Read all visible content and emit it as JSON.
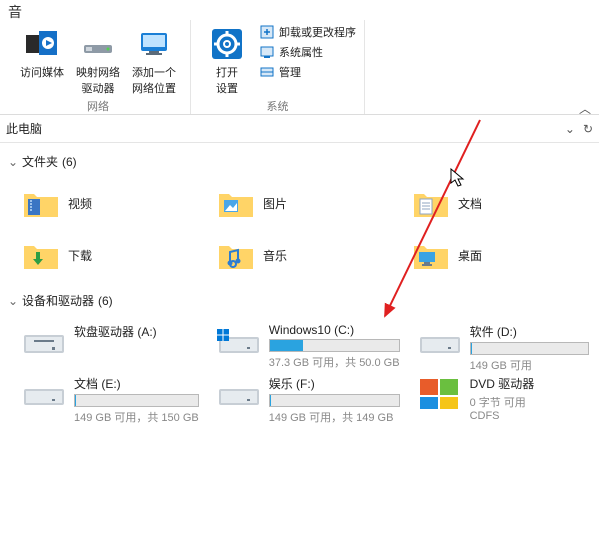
{
  "ribbon": {
    "topchar": "音",
    "btn_media": "访问媒体",
    "btn_mapnet": "映射网络\n驱动器",
    "btn_addloc": "添加一个\n网络位置",
    "group_network": "网络",
    "btn_opensettings": "打开\n设置",
    "item_uninstall": "卸载或更改程序",
    "item_sysprop": "系统属性",
    "item_manage": "管理",
    "group_system": "系统"
  },
  "pathbar": {
    "title": "此电脑"
  },
  "sections": {
    "folders_label": "文件夹",
    "folders_count": "(6)",
    "drives_label": "设备和驱动器",
    "drives_count": "(6)"
  },
  "folders": [
    {
      "label": "视频"
    },
    {
      "label": "图片"
    },
    {
      "label": "文档"
    },
    {
      "label": "下载"
    },
    {
      "label": "音乐"
    },
    {
      "label": "桌面"
    }
  ],
  "drives": {
    "floppy": {
      "name": "软盘驱动器 (A:)"
    },
    "c": {
      "name": "Windows10 (C:)",
      "stat": "37.3 GB 可用，共 50.0 GB",
      "pct": 26
    },
    "d": {
      "name": "软件 (D:)",
      "stat": "149 GB 可用"
    },
    "e": {
      "name": "文档 (E:)",
      "stat": "149 GB 可用，共 150 GB",
      "pct": 1
    },
    "f": {
      "name": "娱乐 (F:)",
      "stat": "149 GB 可用，共 149 GB",
      "pct": 1
    },
    "dvd": {
      "name": "DVD 驱动器",
      "stat": "0 字节 可用",
      "type": "CDFS"
    }
  }
}
